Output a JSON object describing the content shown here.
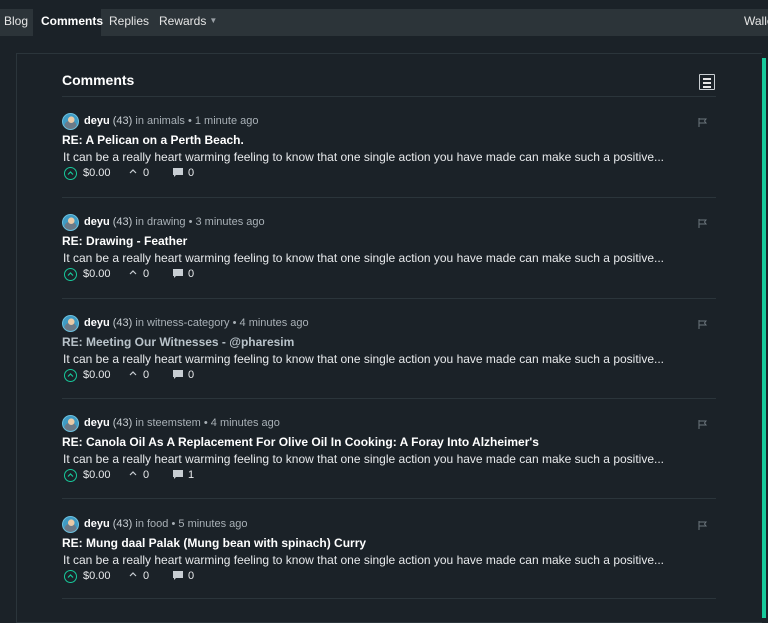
{
  "nav": {
    "tabs": [
      {
        "label": "Blog"
      },
      {
        "label": "Comments"
      },
      {
        "label": "Replies"
      },
      {
        "label": "Rewards"
      }
    ],
    "wallet_label": "Walle"
  },
  "header": {
    "title": "Comments"
  },
  "colors": {
    "accent": "#17c99b",
    "background": "#1b2228",
    "navbar": "#2c3439"
  },
  "comments": [
    {
      "author": "deyu",
      "reputation": "(43)",
      "in_label": "in",
      "category": "animals",
      "time": "1 minute ago",
      "title": "RE: A Pelican on a Perth Beach.",
      "excerpt": "It can be a really heart warming feeling to know that one single action you have made can make such a positive...",
      "payout": "$0.00",
      "votes": "0",
      "replies": "0"
    },
    {
      "author": "deyu",
      "reputation": "(43)",
      "in_label": "in",
      "category": "drawing",
      "time": "3 minutes ago",
      "title": "RE: Drawing - Feather",
      "excerpt": "It can be a really heart warming feeling to know that one single action you have made can make such a positive...",
      "payout": "$0.00",
      "votes": "0",
      "replies": "0"
    },
    {
      "author": "deyu",
      "reputation": "(43)",
      "in_label": "in",
      "category": "witness-category",
      "time": "4 minutes ago",
      "title": "RE: Meeting Our Witnesses - @pharesim",
      "excerpt": "It can be a really heart warming feeling to know that one single action you have made can make such a positive...",
      "payout": "$0.00",
      "votes": "0",
      "replies": "0"
    },
    {
      "author": "deyu",
      "reputation": "(43)",
      "in_label": "in",
      "category": "steemstem",
      "time": "4 minutes ago",
      "title": "RE: Canola Oil As A Replacement For Olive Oil In Cooking: A Foray Into Alzheimer's",
      "excerpt": "It can be a really heart warming feeling to know that one single action you have made can make such a positive...",
      "payout": "$0.00",
      "votes": "0",
      "replies": "1"
    },
    {
      "author": "deyu",
      "reputation": "(43)",
      "in_label": "in",
      "category": "food",
      "time": "5 minutes ago",
      "title": "RE: Mung daal Palak (Mung bean with spinach) Curry",
      "excerpt": "It can be a really heart warming feeling to know that one single action you have made can make such a positive...",
      "payout": "$0.00",
      "votes": "0",
      "replies": "0"
    }
  ]
}
